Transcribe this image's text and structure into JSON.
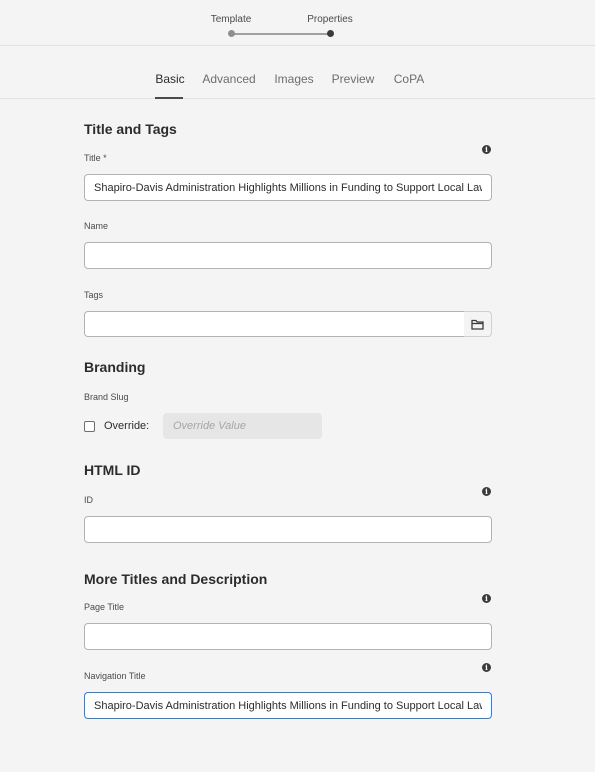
{
  "wizard": {
    "steps": [
      {
        "label": "Template",
        "state": "done"
      },
      {
        "label": "Properties",
        "state": "current"
      }
    ]
  },
  "tabs": [
    {
      "label": "Basic",
      "active": true
    },
    {
      "label": "Advanced",
      "active": false
    },
    {
      "label": "Images",
      "active": false
    },
    {
      "label": "Preview",
      "active": false
    },
    {
      "label": "CoPA",
      "active": false
    }
  ],
  "sections": {
    "title_tags": {
      "heading": "Title and Tags",
      "title_label": "Title *",
      "title_value": "Shapiro-Davis Administration Highlights Millions in Funding to Support Local Law",
      "name_label": "Name",
      "name_value": "",
      "tags_label": "Tags"
    },
    "branding": {
      "heading": "Branding",
      "brand_slug_label": "Brand Slug",
      "override_label": "Override:",
      "override_checked": false,
      "override_placeholder": "Override Value"
    },
    "html_id": {
      "heading": "HTML ID",
      "id_label": "ID",
      "id_value": ""
    },
    "more_titles": {
      "heading": "More Titles and Description",
      "page_title_label": "Page Title",
      "page_title_value": "",
      "nav_title_label": "Navigation Title",
      "nav_title_value": "Shapiro-Davis Administration Highlights Millions in Funding to Support Local Law E"
    }
  },
  "icons": {
    "info": "info-icon",
    "folder": "folder-icon"
  },
  "colors": {
    "background": "#f4f4f4",
    "focus_border": "#2680eb",
    "step_done": "#8e8e8e",
    "step_current": "#3b3b3b"
  }
}
